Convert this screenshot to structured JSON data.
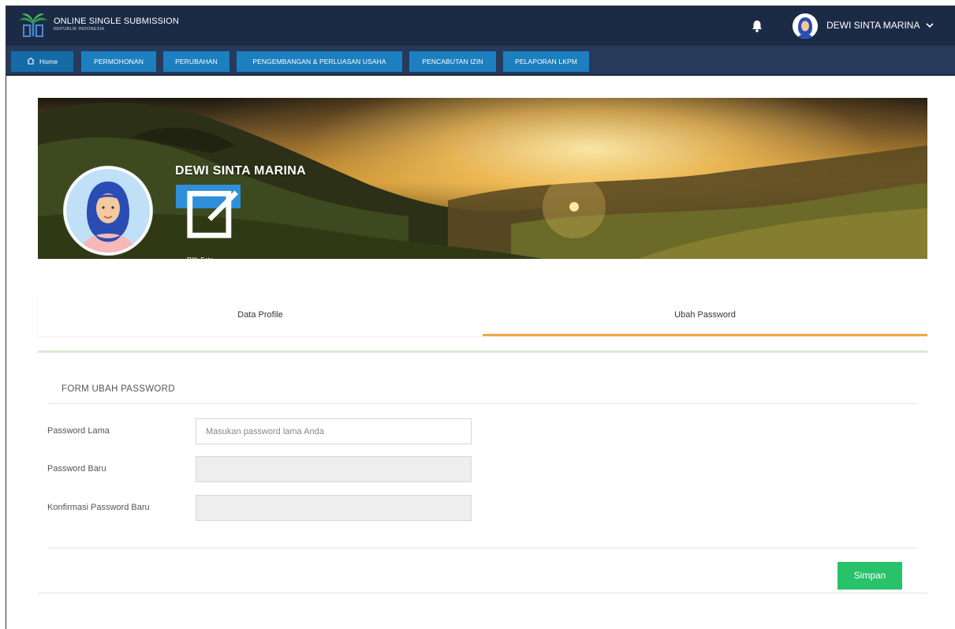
{
  "header": {
    "brand_title": "ONLINE SINGLE SUBMISSION",
    "brand_subtitle": "REPUBLIK INDONESIA",
    "user_name": "DEWI SINTA MARINA",
    "icons": [
      "ministry-logo-icon",
      "bell-icon",
      "user-avatar-icon",
      "chevron-down-icon"
    ]
  },
  "nav": {
    "items": [
      {
        "label": "Home",
        "icon": "home-icon"
      },
      {
        "label": "PERMOHONAN"
      },
      {
        "label": "PERUBAHAN"
      },
      {
        "label": "PENGEMBANGAN & PERLUASAN USAHA"
      },
      {
        "label": "PENCABUTAN IZIN"
      },
      {
        "label": "PELAPORAN LKPM"
      }
    ]
  },
  "profile": {
    "name": "DEWI SINTA MARINA",
    "photo_button": "Pilih Foto",
    "photo_icon": "edit-icon"
  },
  "tabs": [
    {
      "label": "Data Profile",
      "active": false
    },
    {
      "label": "Ubah Password",
      "active": true
    }
  ],
  "form": {
    "title": "FORM UBAH PASSWORD",
    "fields": [
      {
        "label": "Password Lama",
        "placeholder": "Masukan password lama Anda",
        "disabled": false
      },
      {
        "label": "Password Baru",
        "placeholder": "",
        "disabled": true
      },
      {
        "label": "Konfirmasi Password Baru",
        "placeholder": "",
        "disabled": true
      }
    ],
    "submit_label": "Simpan"
  },
  "colors": {
    "topbar": "#1c2b45",
    "navbar": "#263a5c",
    "nav_button": "#1c7fbf",
    "tab_active_underline": "#f0a742",
    "save_button": "#27c26a",
    "photo_button": "#2f8fd8"
  }
}
